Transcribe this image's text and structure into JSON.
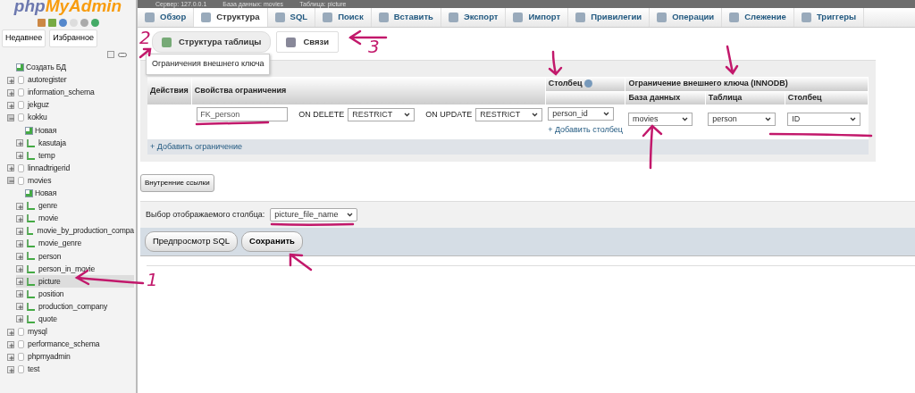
{
  "breadcrumb": [
    "Сервер: 127.0.0.1",
    "База данных: movies",
    "Таблица: picture"
  ],
  "sidebar": {
    "logo": {
      "first": "php",
      "second": "MyAdmin"
    },
    "buttons": [
      "Недавнее",
      "Избранное"
    ],
    "tree": [
      {
        "label": "Создать БД",
        "kind": "new"
      },
      {
        "label": "autoregister",
        "kind": "db",
        "expanded": false
      },
      {
        "label": "information_schema",
        "kind": "db",
        "expanded": false
      },
      {
        "label": "jekguz",
        "kind": "db",
        "expanded": false
      },
      {
        "label": "kokku",
        "kind": "db",
        "expanded": true,
        "children": [
          {
            "label": "Новая",
            "kind": "new"
          },
          {
            "label": "kasutaja",
            "kind": "table",
            "expanded": false,
            "selected": false
          },
          {
            "label": "temp",
            "kind": "table",
            "expanded": false,
            "selected": false
          }
        ]
      },
      {
        "label": "linnadtrigerid",
        "kind": "db",
        "expanded": false
      },
      {
        "label": "movies",
        "kind": "db",
        "expanded": true,
        "children": [
          {
            "label": "Новая",
            "kind": "new"
          },
          {
            "label": "genre",
            "kind": "table",
            "expanded": false,
            "selected": false
          },
          {
            "label": "movie",
            "kind": "table",
            "expanded": false,
            "selected": false
          },
          {
            "label": "movie_by_production_compa",
            "kind": "table",
            "expanded": false,
            "selected": false
          },
          {
            "label": "movie_genre",
            "kind": "table",
            "expanded": false,
            "selected": false
          },
          {
            "label": "person",
            "kind": "table",
            "expanded": false,
            "selected": false
          },
          {
            "label": "person_in_movie",
            "kind": "table",
            "expanded": false,
            "selected": false
          },
          {
            "label": "picture",
            "kind": "table",
            "expanded": false,
            "selected": true
          },
          {
            "label": "position",
            "kind": "table",
            "expanded": false,
            "selected": false
          },
          {
            "label": "production_company",
            "kind": "table",
            "expanded": false,
            "selected": false
          },
          {
            "label": "quote",
            "kind": "table",
            "expanded": false,
            "selected": false
          }
        ]
      },
      {
        "label": "mysql",
        "kind": "db",
        "expanded": false
      },
      {
        "label": "performance_schema",
        "kind": "db",
        "expanded": false
      },
      {
        "label": "phpmyadmin",
        "kind": "db",
        "expanded": false
      },
      {
        "label": "test",
        "kind": "db",
        "expanded": false
      }
    ]
  },
  "tabs": [
    {
      "label": "Обзор",
      "selected": false
    },
    {
      "label": "Структура",
      "selected": true
    },
    {
      "label": "SQL",
      "selected": false
    },
    {
      "label": "Поиск",
      "selected": false
    },
    {
      "label": "Вставить",
      "selected": false
    },
    {
      "label": "Экспорт",
      "selected": false
    },
    {
      "label": "Импорт",
      "selected": false
    },
    {
      "label": "Привилегии",
      "selected": false
    },
    {
      "label": "Операции",
      "selected": false
    },
    {
      "label": "Слежение",
      "selected": false
    },
    {
      "label": "Триггеры",
      "selected": false
    }
  ],
  "subtabs": [
    {
      "label": "Структура таблицы",
      "selected": false
    },
    {
      "label": "Связи",
      "selected": true
    }
  ],
  "foreign_keys": {
    "legend": "Ограничения внешнего ключа",
    "columns": {
      "actions": "Действия",
      "properties": "Свойства ограничения",
      "column": "Столбец",
      "fk_group": "Ограничение внешнего ключа (INNODB)",
      "database": "База данных",
      "table": "Таблица",
      "fk_column": "Столбец"
    },
    "rows": [
      {
        "name": "FK_person",
        "on_delete_label": "ON DELETE",
        "on_delete": "RESTRICT",
        "on_update_label": "ON UPDATE",
        "on_update": "RESTRICT",
        "column": "person_id",
        "add_column": "+ Добавить столбец",
        "database": "movies",
        "table": "person",
        "fk_column": "ID"
      }
    ],
    "add_constraint": "+ Добавить ограничение"
  },
  "internal_links_button": "Внутренние ссылки",
  "display_column": {
    "label": "Выбор отображаемого столбца:",
    "value": "picture_file_name"
  },
  "buttons": [
    "Предпросмотр SQL",
    "Сохранить"
  ],
  "annotations": [
    "1",
    "2",
    "3"
  ]
}
